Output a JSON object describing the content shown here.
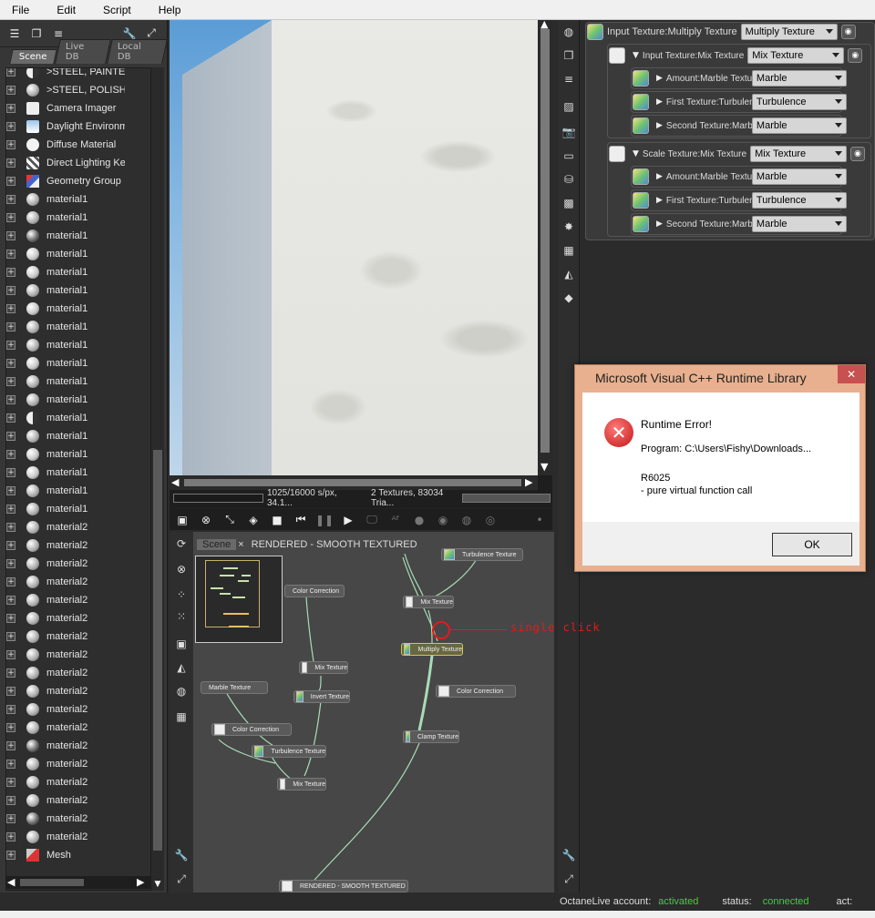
{
  "menu": [
    "File",
    "Edit",
    "Script",
    "Help"
  ],
  "left_tabs": [
    "Scene",
    "Live DB",
    "Local DB"
  ],
  "tree_items": [
    {
      "label": ">STEEL, PAINTED",
      "icon": "half"
    },
    {
      "label": ">STEEL, POLISHED",
      "icon": "mat"
    },
    {
      "label": "Camera Imager",
      "icon": "cam"
    },
    {
      "label": "Daylight Environment",
      "icon": "sky"
    },
    {
      "label": "Diffuse Material",
      "icon": "diff"
    },
    {
      "label": "Direct Lighting Kernel",
      "icon": "kern"
    },
    {
      "label": "Geometry Group",
      "icon": "geo"
    },
    {
      "label": "material1",
      "icon": "mat"
    },
    {
      "label": "material1",
      "icon": "mat"
    },
    {
      "label": "material1",
      "icon": "glossy"
    },
    {
      "label": "material1",
      "icon": "mat2"
    },
    {
      "label": "material1",
      "icon": "mat2"
    },
    {
      "label": "material1",
      "icon": "mat"
    },
    {
      "label": "material1",
      "icon": "mat2"
    },
    {
      "label": "material1",
      "icon": "mat"
    },
    {
      "label": "material1",
      "icon": "mat"
    },
    {
      "label": "material1",
      "icon": "mat2"
    },
    {
      "label": "material1",
      "icon": "mat"
    },
    {
      "label": "material1",
      "icon": "mat"
    },
    {
      "label": "material1",
      "icon": "half"
    },
    {
      "label": "material1",
      "icon": "mat"
    },
    {
      "label": "material1",
      "icon": "mat2"
    },
    {
      "label": "material1",
      "icon": "mat2"
    },
    {
      "label": "material1",
      "icon": "mat"
    },
    {
      "label": "material1",
      "icon": "mat"
    },
    {
      "label": "material2",
      "icon": "mat"
    },
    {
      "label": "material2",
      "icon": "mat"
    },
    {
      "label": "material2",
      "icon": "mat"
    },
    {
      "label": "material2",
      "icon": "mat"
    },
    {
      "label": "material2",
      "icon": "mat"
    },
    {
      "label": "material2",
      "icon": "mat"
    },
    {
      "label": "material2",
      "icon": "mat"
    },
    {
      "label": "material2",
      "icon": "mat"
    },
    {
      "label": "material2",
      "icon": "mat"
    },
    {
      "label": "material2",
      "icon": "mat"
    },
    {
      "label": "material2",
      "icon": "mat"
    },
    {
      "label": "material2",
      "icon": "mat"
    },
    {
      "label": "material2",
      "icon": "glossy"
    },
    {
      "label": "material2",
      "icon": "mat"
    },
    {
      "label": "material2",
      "icon": "mat"
    },
    {
      "label": "material2",
      "icon": "mat"
    },
    {
      "label": "material2",
      "icon": "glossy"
    },
    {
      "label": "material2",
      "icon": "mat"
    },
    {
      "label": "Mesh",
      "icon": "mesh"
    }
  ],
  "viewport": {
    "status_samples": "1025/16000 s/px, 34.1...",
    "status_info": "2 Textures, 83034 Tria..."
  },
  "inspector": {
    "root": {
      "label": "Input Texture:Multiply Texture",
      "value": "Multiply Texture"
    },
    "group1": {
      "label": "Input Texture:Mix Texture",
      "value": "Mix Texture",
      "children": [
        {
          "label": "Amount:Marble Texture",
          "value": "Marble"
        },
        {
          "label": "First Texture:Turbulence",
          "value": "Turbulence"
        },
        {
          "label": "Second Texture:Marble",
          "value": "Marble"
        }
      ]
    },
    "group2": {
      "label": "Scale Texture:Mix Texture",
      "value": "Mix Texture",
      "children": [
        {
          "label": "Amount:Marble Texture",
          "value": "Marble"
        },
        {
          "label": "First Texture:Turbulence",
          "value": "Turbulence"
        },
        {
          "label": "Second Texture:Marble",
          "value": "Marble"
        }
      ]
    }
  },
  "dialog": {
    "title": "Microsoft Visual C++ Runtime Library",
    "close": "✕",
    "heading": "Runtime Error!",
    "program": "Program: C:\\Users\\Fishy\\Downloads...",
    "code": "R6025",
    "message": "- pure virtual function call",
    "ok": "OK"
  },
  "graph": {
    "tab_scene": "Scene",
    "tab_close": "×",
    "tab_rendered": "RENDERED - SMOOTH TEXTURED",
    "annotation": "single click",
    "nodes": {
      "turbulence_top": "Turbulence Texture",
      "color_correction_1": "Color Correction",
      "mix_top": "Mix Texture",
      "multiply": "Multiply Texture",
      "mix_mid": "Mix Texture",
      "invert": "Invert Texture",
      "color_correction_2": "Color Correction",
      "marble": "Marble Texture",
      "color_correction_3": "Color Correction",
      "clamp": "Clamp Texture",
      "turbulence_bottom": "Turbulence Texture",
      "mix_bottom": "Mix Texture",
      "rendered": "RENDERED - SMOOTH TEXTURED"
    }
  },
  "status": {
    "account_label": "OctaneLive account:",
    "account_value": "activated",
    "status_label": "status:",
    "status_value": "connected",
    "act_label": "act:"
  },
  "colors": {
    "dialog_frame": "#e8b08e",
    "status_green": "#3bd33b",
    "annotation_red": "#e41a1a",
    "selected_node": "#d9c34a"
  }
}
